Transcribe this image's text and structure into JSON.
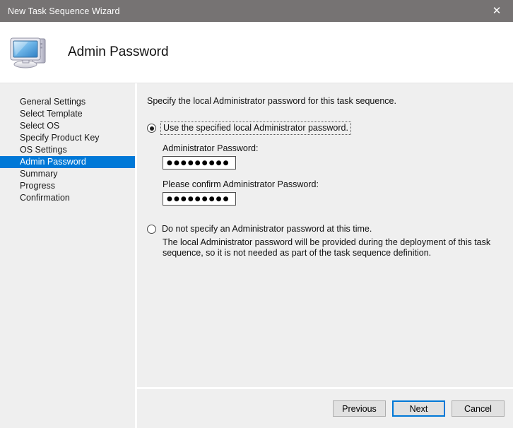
{
  "window": {
    "title": "New Task Sequence Wizard",
    "close_icon": "close-icon",
    "close_glyph": "✕",
    "titlebar_color": "#767373",
    "accent_color": "#0078d7"
  },
  "header": {
    "title": "Admin Password",
    "icon": "computer-icon"
  },
  "sidebar": {
    "items": [
      {
        "label": "General Settings",
        "selected": false
      },
      {
        "label": "Select Template",
        "selected": false
      },
      {
        "label": "Select OS",
        "selected": false
      },
      {
        "label": "Specify Product Key",
        "selected": false
      },
      {
        "label": "OS Settings",
        "selected": false
      },
      {
        "label": "Admin Password",
        "selected": true
      },
      {
        "label": "Summary",
        "selected": false
      },
      {
        "label": "Progress",
        "selected": false
      },
      {
        "label": "Confirmation",
        "selected": false
      }
    ]
  },
  "content": {
    "intro": "Specify the local Administrator password for this task sequence.",
    "option_specify": {
      "label": "Use the specified local Administrator password.",
      "selected": true,
      "password_label": "Administrator Password:",
      "password_value": "●●●●●●●●●",
      "confirm_label": "Please confirm Administrator Password:",
      "confirm_value": "●●●●●●●●●"
    },
    "option_skip": {
      "label": "Do not specify an Administrator password at this time.",
      "selected": false,
      "description": "The local Administrator password will be provided during the deployment of this task sequence, so it is not needed as part of the task sequence definition."
    }
  },
  "footer": {
    "previous_label": "Previous",
    "next_label": "Next",
    "cancel_label": "Cancel"
  }
}
